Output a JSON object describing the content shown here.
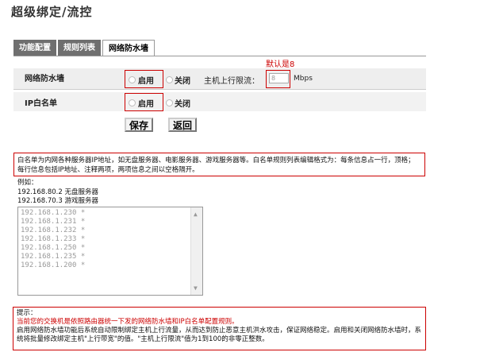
{
  "page": {
    "title": "超级绑定/流控"
  },
  "tabs": [
    {
      "label": "功能配置",
      "active": false
    },
    {
      "label": "规则列表",
      "active": false
    },
    {
      "label": "网络防水墙",
      "active": true
    }
  ],
  "firewall": {
    "label": "网络防水墙",
    "enable_label": "启用",
    "disable_label": "关闭",
    "upstream_label": "主机上行限流：",
    "upstream_value": "8",
    "unit": "Mbps",
    "default_note": "默认是8"
  },
  "whitelist": {
    "label": "IP白名单",
    "enable_label": "启用",
    "disable_label": "关闭"
  },
  "buttons": {
    "save": "保存",
    "back": "返回"
  },
  "info": {
    "text": "白名单为内网各种服务器IP地址，如无盘服务器、电影服务器、游戏服务器等。白名单规则列表编辑格式为：每条信息占一行，顶格；每行信息包括IP地址、注释两项，两项信息之间以空格隔开。",
    "example_title": "例如：",
    "example_lines": [
      "192.168.80.2 无盘服务器",
      "192.168.70.3 游戏服务器"
    ]
  },
  "textarea_lines": [
    "192.168.1.230 *",
    "192.168.1.231 *",
    "192.168.1.232 *",
    "192.168.1.233 *",
    "192.168.1.250 *",
    "192.168.1.235 *",
    "192.168.1.200 *"
  ],
  "tip": {
    "title": "提示：",
    "line1": "当前您的交换机是依照路由器统一下发的网络防水墙和IP白名单配置规则。",
    "line2": "启用网络防水墙功能后系统自动限制绑定主机上行流量，从而达到防止恶意主机洪水攻击，保证网络稳定。启用和关闭网络防水墙时，系统将批量修改绑定主机\"上行带宽\"的值。\"主机上行限流\"值为1到100的非零正整数。"
  },
  "colors": {
    "accent_red": "#cc0000",
    "tab_inactive": "#6f6f6f"
  }
}
